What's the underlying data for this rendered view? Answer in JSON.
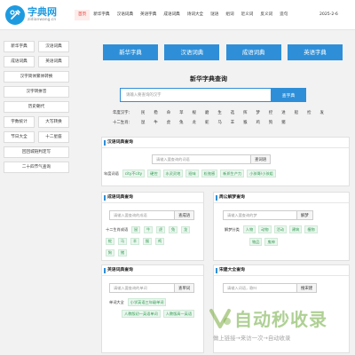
{
  "header": {
    "logo_title": "字典网",
    "logo_sub": "zidianwang.cn",
    "nav": [
      "首页",
      "新华字典",
      "汉语词典",
      "英语字典",
      "成语词典",
      "诗词大全",
      "谜语",
      "组词",
      "近义词",
      "反义词",
      "造句"
    ],
    "date": "2025-2-6"
  },
  "sidebar": {
    "items": [
      "新华字典",
      "汉语词典",
      "成语词典",
      "英语词典",
      "汉字简体繁体转换",
      "汉字转拼音",
      "历史朝代",
      "字数统计",
      "大写转换",
      "节日大全",
      "十二星座",
      "回回城链判定写",
      "二十四节气查询"
    ]
  },
  "tabs": [
    "新华字典",
    "汉语词典",
    "成语词典",
    "英语字典"
  ],
  "xinhua": {
    "title": "新华字典查询",
    "placeholder": "请输入要查询的汉字",
    "button": "查字典",
    "rows": [
      {
        "label": "年度汉字：",
        "items": [
          "民",
          "稳",
          "命",
          "苹",
          "规",
          "磨",
          "生",
          "选",
          "挥",
          "梦",
          "控",
          "进",
          "船",
          "捡",
          "发"
        ]
      },
      {
        "label": "十二生肖：",
        "items": [
          "鼠",
          "牛",
          "虎",
          "兔",
          "龙",
          "蛇",
          "马",
          "羊",
          "猴",
          "鸡",
          "狗",
          "猪"
        ]
      }
    ]
  },
  "panels": {
    "hanyu": {
      "title": "汉语词典查询",
      "placeholder": "请输入要查询的词语",
      "button": "查词语",
      "label": "年度词语",
      "chips": [
        "city不city",
        "硬控",
        "水灵灵地",
        "班味",
        "松弛感",
        "新质生产力",
        "小孩哥/小孩姐"
      ]
    },
    "chengyu": {
      "title": "成语词典查询",
      "placeholder": "请输入要查询的成语",
      "button": "查成语",
      "label": "十二生肖成语",
      "chips_row1": [
        "鼠",
        "牛",
        "虎",
        "兔",
        "龙"
      ],
      "chips_row2": [
        "蛇",
        "马",
        "羊",
        "猴",
        "鸡"
      ],
      "chips_row3": [
        "狗",
        "猪"
      ]
    },
    "jiemeng": {
      "title": "周公解梦查询",
      "placeholder": "请输入要查询的梦",
      "button": "解梦",
      "label": "解梦分类",
      "chips_row1": [
        "人物",
        "动物",
        "活动",
        "建筑",
        "植物"
      ],
      "chips_row2": [
        "物品",
        "鬼神"
      ]
    },
    "yingyu": {
      "title": "英语词典查询",
      "placeholder": "请输入要查询的单词",
      "button": "查单词",
      "label": "单词大全",
      "chips": [
        "小学英语三年级单词",
        "人教版初一英语单词",
        "人教版高一英语"
      ]
    },
    "qiming": {
      "title": "宋建大全查询",
      "placeholder": "请输入词语，歌叶",
      "button": "搜宋建"
    }
  },
  "watermark": {
    "big": "自动秒收录",
    "small": "做上链接→来访一次→自动收录"
  }
}
